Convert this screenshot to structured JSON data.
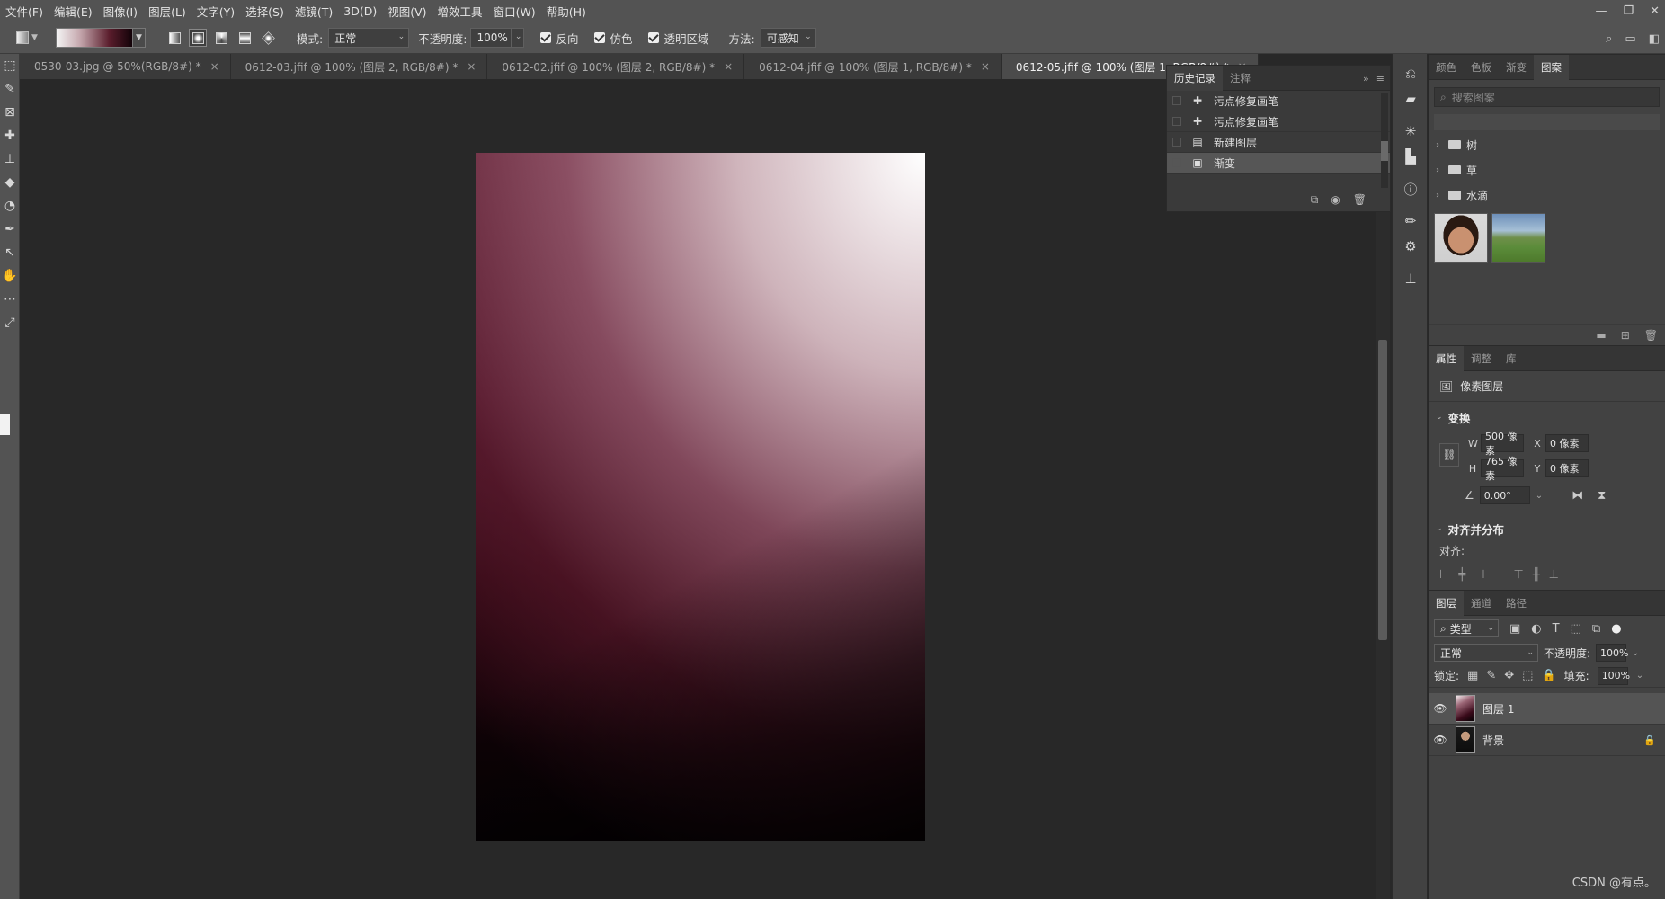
{
  "menubar": {
    "items": [
      "文件(F)",
      "编辑(E)",
      "图像(I)",
      "图层(L)",
      "文字(Y)",
      "选择(S)",
      "滤镜(T)",
      "3D(D)",
      "视图(V)",
      "增效工具",
      "窗口(W)",
      "帮助(H)"
    ]
  },
  "options": {
    "mode_label": "模式:",
    "mode_value": "正常",
    "opacity_label": "不透明度:",
    "opacity_value": "100%",
    "reverse_label": "反向",
    "dither_label": "仿色",
    "transparency_label": "透明区域",
    "method_label": "方法:",
    "method_value": "可感知"
  },
  "doc_tabs": [
    {
      "label": "0530-03.jpg @ 50%(RGB/8#) *"
    },
    {
      "label": "0612-03.jfif @ 100% (图层 2, RGB/8#) *"
    },
    {
      "label": "0612-02.jfif @ 100% (图层 2, RGB/8#) *"
    },
    {
      "label": "0612-04.jfif @ 100% (图层 1, RGB/8#) *"
    },
    {
      "label": "0612-05.jfif @ 100% (图层 1, RGB/8#) *"
    }
  ],
  "history": {
    "tabs": [
      "历史记录",
      "注释"
    ],
    "items": [
      {
        "label": "污点修复画笔"
      },
      {
        "label": "污点修复画笔"
      },
      {
        "label": "新建图层"
      },
      {
        "label": "渐变"
      }
    ]
  },
  "patterns_panel": {
    "tabs": [
      "颜色",
      "色板",
      "渐变",
      "图案"
    ],
    "search_placeholder": "搜索图案",
    "folders": [
      "树",
      "草",
      "水滴"
    ]
  },
  "properties_panel": {
    "tabs": [
      "属性",
      "调整",
      "库"
    ],
    "layer_type": "像素图层",
    "transform_title": "变换",
    "w_label": "W",
    "w_value": "500 像素",
    "h_label": "H",
    "h_value": "765 像素",
    "x_label": "X",
    "x_value": "0 像素",
    "y_label": "Y",
    "y_value": "0 像素",
    "angle_value": "0.00°",
    "align_title": "对齐并分布",
    "align_label": "对齐:",
    "more": "···"
  },
  "layers_panel": {
    "tabs": [
      "图层",
      "通道",
      "路径"
    ],
    "filter_value": "类型",
    "blend_value": "正常",
    "opacity_label": "不透明度:",
    "opacity_value": "100%",
    "lock_label": "锁定:",
    "fill_label": "填充:",
    "fill_value": "100%",
    "layers": [
      {
        "name": "图层 1"
      },
      {
        "name": "背景"
      }
    ]
  },
  "watermark": "CSDN @有点。"
}
